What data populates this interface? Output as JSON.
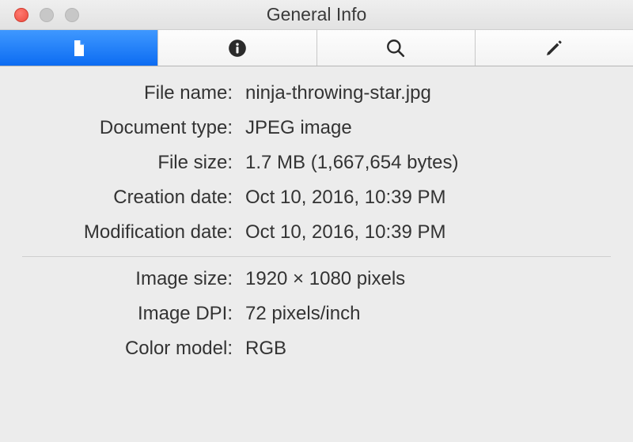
{
  "window": {
    "title": "General Info"
  },
  "tabs": {
    "file": "file-icon",
    "info": "info-icon",
    "search": "search-icon",
    "edit": "edit-icon"
  },
  "fields": {
    "file_name": {
      "label": "File name:",
      "value": "ninja-throwing-star.jpg"
    },
    "document_type": {
      "label": "Document type:",
      "value": "JPEG image"
    },
    "file_size": {
      "label": "File size:",
      "value": "1.7 MB (1,667,654 bytes)"
    },
    "creation_date": {
      "label": "Creation date:",
      "value": "Oct 10, 2016, 10:39 PM"
    },
    "modification_date": {
      "label": "Modification date:",
      "value": "Oct 10, 2016, 10:39 PM"
    },
    "image_size": {
      "label": "Image size:",
      "value": "1920 × 1080 pixels"
    },
    "image_dpi": {
      "label": "Image DPI:",
      "value": "72 pixels/inch"
    },
    "color_model": {
      "label": "Color model:",
      "value": "RGB"
    }
  }
}
